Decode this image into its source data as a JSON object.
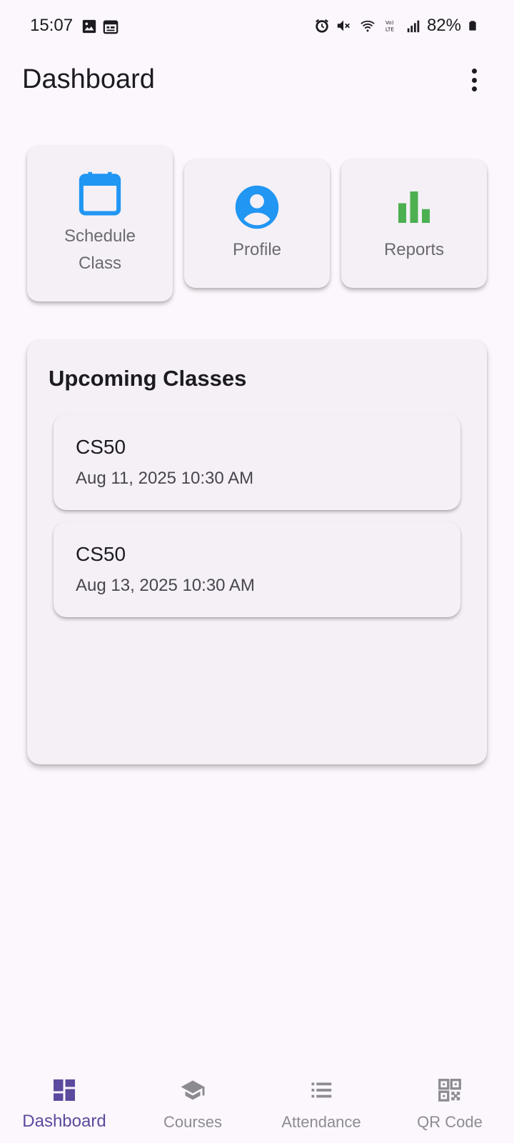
{
  "status_bar": {
    "time": "15:07",
    "battery": "82%",
    "icons": [
      "image-icon",
      "calendar-icon",
      "alarm-icon",
      "mute-icon",
      "wifi-icon",
      "volte-icon",
      "signal-icon",
      "battery-icon"
    ]
  },
  "app_bar": {
    "title": "Dashboard",
    "menu_icon": "more-vert-icon"
  },
  "tiles": [
    {
      "label": "Schedule Class",
      "icon": "calendar-icon",
      "color": "#2196f3"
    },
    {
      "label": "Profile",
      "icon": "account-circle-icon",
      "color": "#2196f3"
    },
    {
      "label": "Reports",
      "icon": "bar-chart-icon",
      "color": "#4caf50"
    }
  ],
  "upcoming": {
    "title": "Upcoming Classes",
    "classes": [
      {
        "name": "CS50",
        "date": "Aug 11, 2025 10:30 AM"
      },
      {
        "name": "CS50",
        "date": "Aug 13, 2025 10:30 AM"
      }
    ]
  },
  "bottom_nav": {
    "active_color": "#5b4a9e",
    "items": [
      {
        "label": "Dashboard",
        "icon": "dashboard-icon",
        "active": true
      },
      {
        "label": "Courses",
        "icon": "school-icon",
        "active": false
      },
      {
        "label": "Attendance",
        "icon": "list-icon",
        "active": false
      },
      {
        "label": "QR Code",
        "icon": "qr-code-icon",
        "active": false
      }
    ]
  }
}
